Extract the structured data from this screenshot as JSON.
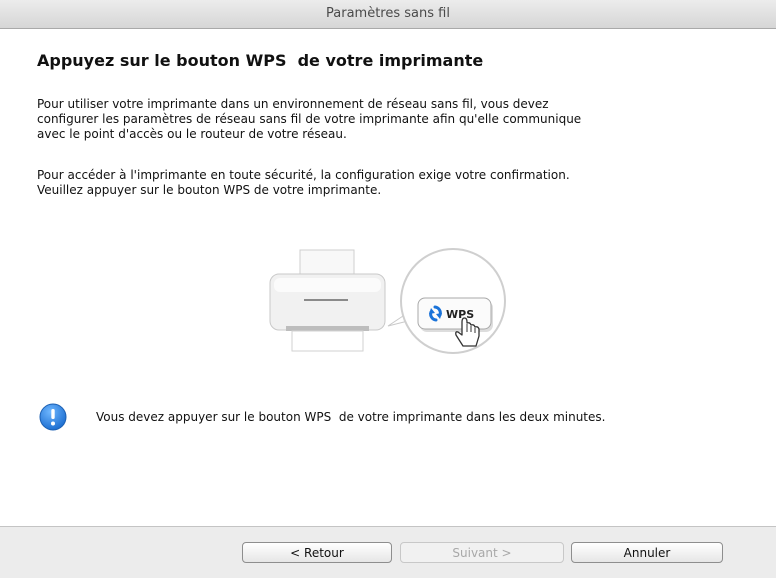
{
  "window": {
    "title": "Paramètres sans fil"
  },
  "main": {
    "heading": "Appuyez sur le bouton WPS  de votre imprimante",
    "paragraph1": "Pour utiliser votre imprimante dans un environnement de réseau sans fil, vous devez\nconfigurer les paramètres de réseau sans fil de votre imprimante afin qu'elle communique\navec le point d'accès ou le routeur de votre réseau.",
    "paragraph2": "Pour accéder à l'imprimante en toute sécurité, la configuration exige votre confirmation.\nVeuillez appuyer sur le bouton WPS  de votre imprimante.",
    "illustration": {
      "wps_label": "WPS",
      "icons": [
        "printer-icon",
        "wps-button-icon",
        "hand-pointer-icon"
      ]
    },
    "notice": {
      "icon": "info-icon",
      "text": "Vous devez appuyer sur le bouton WPS  de votre imprimante dans les deux minutes."
    }
  },
  "footer": {
    "back_label": "< Retour",
    "next_label": "Suivant >",
    "cancel_label": "Annuler"
  },
  "colors": {
    "info_icon": "#2f86e0",
    "wps_arrows": "#1a73d9"
  }
}
